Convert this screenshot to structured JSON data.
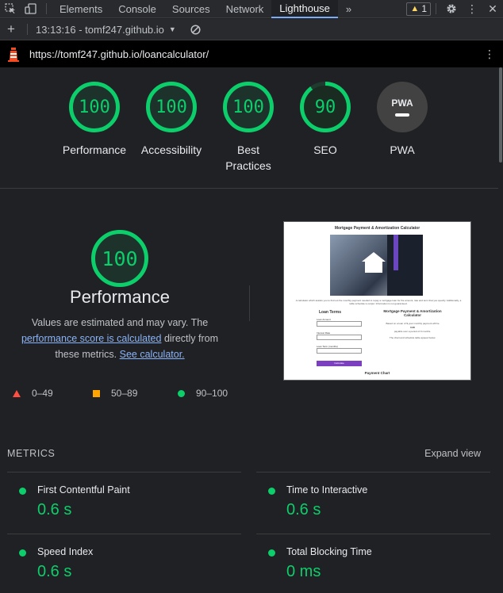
{
  "devtools": {
    "tabs": [
      "Elements",
      "Console",
      "Sources",
      "Network",
      "Lighthouse"
    ],
    "more": "»",
    "warning_count": "1",
    "report_selector": "13:13:16 - tomf247.github.io",
    "url": "https://tomf247.github.io/loancalculator/"
  },
  "gauges": [
    {
      "score": "100",
      "label": "Performance"
    },
    {
      "score": "100",
      "label": "Accessibility"
    },
    {
      "score": "100",
      "label": "Best Practices"
    },
    {
      "score": "90",
      "label": "SEO"
    },
    {
      "score": "PWA",
      "label": "PWA"
    }
  ],
  "performance": {
    "score": "100",
    "title": "Performance",
    "desc_prefix": "Values are estimated and may vary. The",
    "desc_link": "performance score is calculated",
    "desc_middle": "directly from these metrics.",
    "desc_link2": "See calculator.",
    "legend": [
      {
        "range": "0–49",
        "color": "#ff4e42"
      },
      {
        "range": "50–89",
        "color": "#ffa400"
      },
      {
        "range": "90–100",
        "color": "#0cce6b"
      }
    ]
  },
  "screenshot": {
    "page_title": "Mortgage Payment & Amortization Calculator",
    "intro": "A calculator which assists you to find out the monthly payment needed to repay a mortgage loan for the amount, rate and term that you specify. Additionally, a table schedule is output. Information is not guaranteed.",
    "loan_terms": "Loan Terms",
    "loan_amount": "Loan Amount",
    "interest_rate": "Interest Rate",
    "loan_term": "Loan Term (months)",
    "calculate": "Calculate",
    "right_title": "Mortgage Payment & Amortization Calculator",
    "right_line1": "Based on a loan of $ your monthly payment will be",
    "right_line2": "0.00",
    "right_line3": "payable over a period of 0 months.",
    "right_line4": "The chart and schedule table appear below.",
    "payment_chart": "Payment Chart"
  },
  "metrics": {
    "header": "METRICS",
    "expand": "Expand view",
    "items": [
      {
        "name": "First Contentful Paint",
        "value": "0.6 s"
      },
      {
        "name": "Time to Interactive",
        "value": "0.6 s"
      },
      {
        "name": "Speed Index",
        "value": "0.6 s"
      },
      {
        "name": "Total Blocking Time",
        "value": "0 ms"
      }
    ]
  },
  "colors": {
    "pass": "#0cce6b",
    "average": "#ffa400",
    "fail": "#ff4e42",
    "link": "#8ab4f8"
  }
}
